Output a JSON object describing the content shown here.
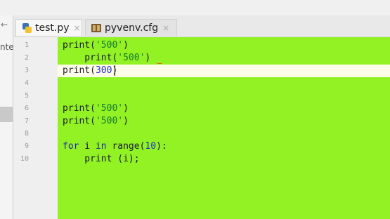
{
  "tabs": [
    {
      "label": "test.py",
      "icon": "python-file-icon",
      "active": true
    },
    {
      "label": "pyvenv.cfg",
      "icon": "config-file-icon",
      "active": false
    }
  ],
  "tab_close_glyph": "×",
  "left_panel": {
    "arrow_glyph": "←",
    "truncated_text": "nte"
  },
  "editor": {
    "background": "#92f224",
    "current_line": 3,
    "line_numbers": [
      "1",
      "2",
      "3",
      "4",
      "5",
      "6",
      "7",
      "8",
      "9",
      "10"
    ],
    "lines": [
      [
        {
          "t": "print(",
          "c": ""
        },
        {
          "t": "'500'",
          "c": "str"
        },
        {
          "t": ")",
          "c": ""
        }
      ],
      [
        {
          "t": "    print(",
          "c": ""
        },
        {
          "t": "'500'",
          "c": "str"
        },
        {
          "t": ")",
          "c": ""
        }
      ],
      [
        {
          "t": "print(",
          "c": ""
        },
        {
          "t": "300",
          "c": "num"
        },
        {
          "t": ")",
          "c": ""
        }
      ],
      [],
      [],
      [
        {
          "t": "print(",
          "c": ""
        },
        {
          "t": "'500'",
          "c": "str"
        },
        {
          "t": ")",
          "c": ""
        }
      ],
      [
        {
          "t": "print(",
          "c": ""
        },
        {
          "t": "'500'",
          "c": "str"
        },
        {
          "t": ")",
          "c": ""
        }
      ],
      [],
      [
        {
          "t": "for",
          "c": "kw"
        },
        {
          "t": " i ",
          "c": ""
        },
        {
          "t": "in",
          "c": "kw"
        },
        {
          "t": " range(",
          "c": ""
        },
        {
          "t": "10",
          "c": "num"
        },
        {
          "t": "):",
          "c": ""
        }
      ],
      [
        {
          "t": "    print (i);",
          "c": ""
        }
      ]
    ]
  }
}
